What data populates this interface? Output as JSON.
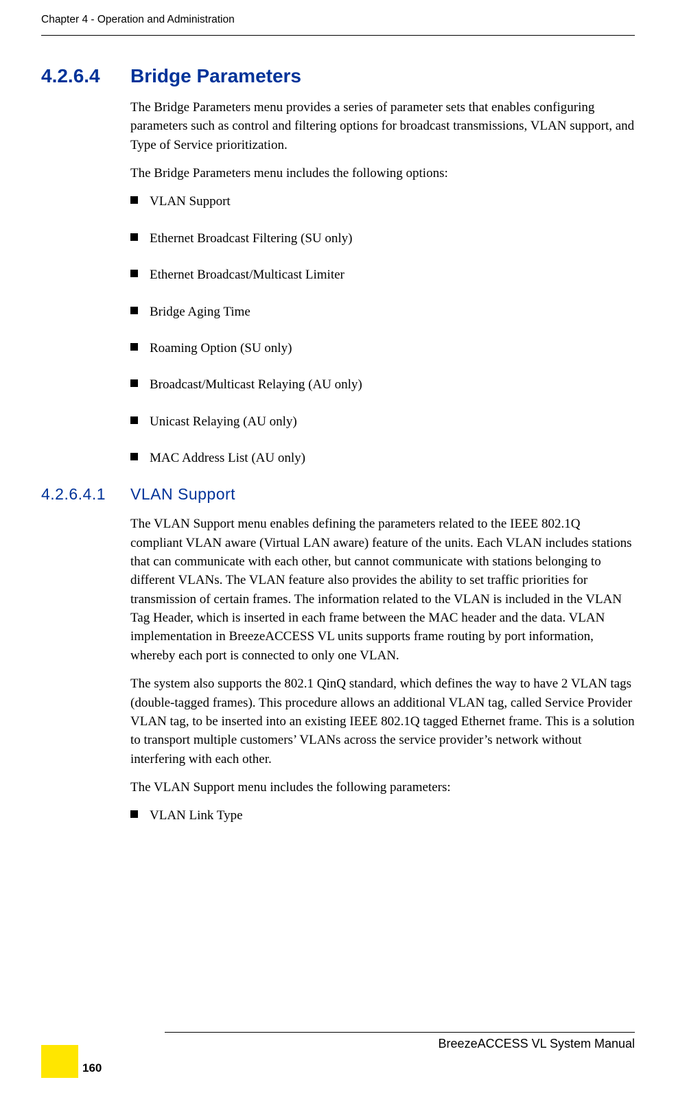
{
  "running_header": "Chapter 4 - Operation and Administration",
  "sections": {
    "bridge": {
      "number": "4.2.6.4",
      "title": "Bridge Parameters",
      "intro1": "The Bridge Parameters menu provides a series of parameter sets that enables configuring parameters such as control and filtering options for broadcast transmissions, VLAN support, and Type of Service prioritization.",
      "intro2": "The Bridge Parameters menu includes the following options:",
      "options": [
        "VLAN Support",
        "Ethernet Broadcast Filtering (SU only)",
        "Ethernet Broadcast/Multicast Limiter",
        "Bridge Aging Time",
        "Roaming Option (SU only)",
        "Broadcast/Multicast Relaying (AU only)",
        "Unicast Relaying (AU only)",
        "MAC Address List (AU only)"
      ]
    },
    "vlan": {
      "number": "4.2.6.4.1",
      "title": "VLAN Support",
      "para1": "The VLAN Support menu enables defining the parameters related to the IEEE 802.1Q compliant VLAN aware (Virtual LAN aware) feature of the units. Each VLAN includes stations that can communicate with each other, but cannot communicate with stations belonging to different VLANs. The VLAN feature also provides the ability to set traffic priorities for transmission of certain frames. The information related to the VLAN is included in the VLAN Tag Header, which is inserted in each frame between the MAC header and the data. VLAN implementation in BreezeACCESS VL units supports frame routing by port information, whereby each port is connected to only one VLAN.",
      "para2": "The system also supports the 802.1 QinQ standard, which defines the way to have 2 VLAN tags (double-tagged frames). This procedure allows an additional VLAN tag, called Service Provider VLAN tag, to be inserted into an existing IEEE 802.1Q tagged Ethernet frame. This is a solution to transport multiple customers’ VLANs across the service provider’s network without interfering with each other.",
      "para3": "The VLAN Support menu includes the following parameters:",
      "options": [
        "VLAN Link Type"
      ]
    }
  },
  "footer": {
    "manual_title": "BreezeACCESS VL System Manual",
    "page_number": "160"
  }
}
